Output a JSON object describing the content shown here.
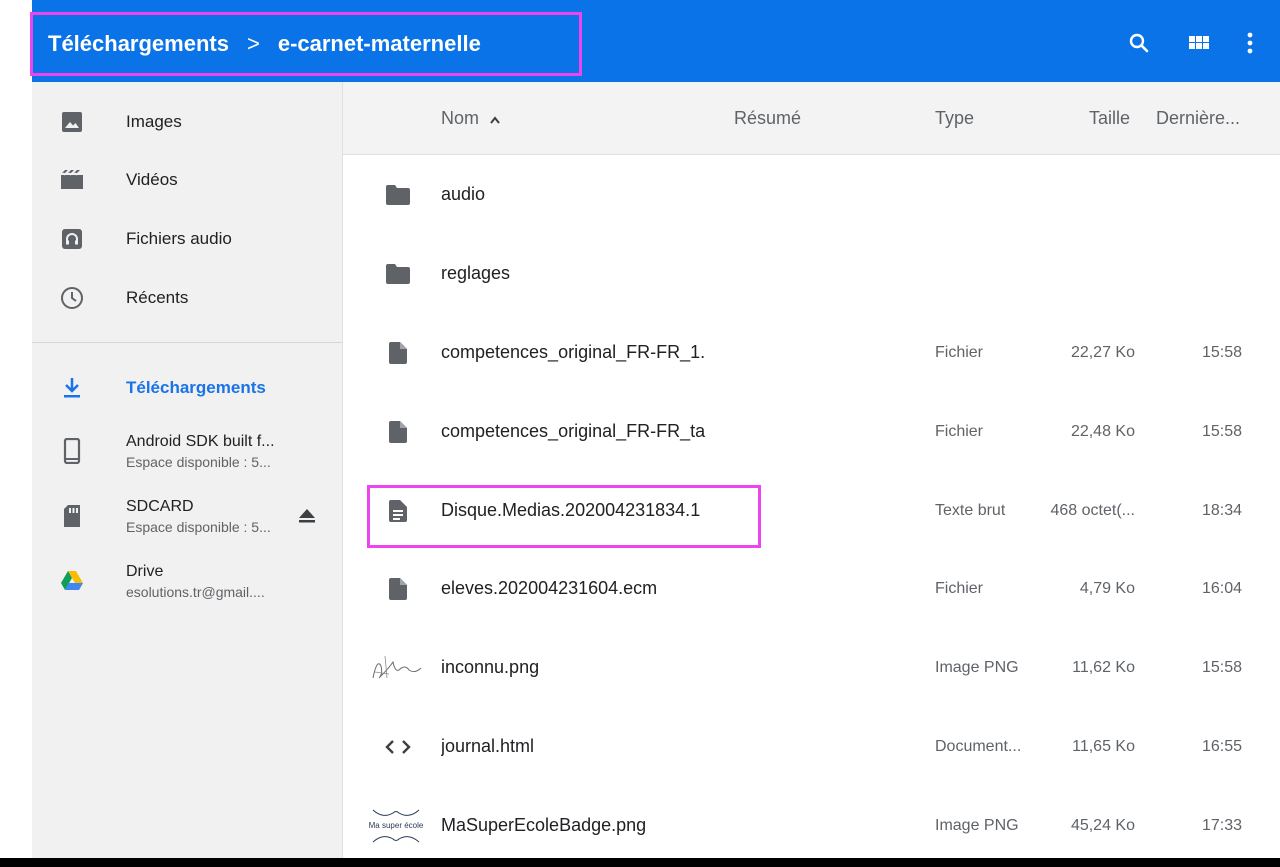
{
  "toolbar": {
    "breadcrumbs": [
      "Téléchargements",
      "e-carnet-maternelle"
    ],
    "separator": ">",
    "icons": [
      "search-icon",
      "grid-view-icon",
      "more-vert-icon"
    ],
    "color": "#0a73e8"
  },
  "sidebar": {
    "items": [
      {
        "label": "Images",
        "icon": "image-icon"
      },
      {
        "label": "Vidéos",
        "icon": "video-icon"
      },
      {
        "label": "Fichiers audio",
        "icon": "audio-icon"
      },
      {
        "label": "Récents",
        "icon": "clock-icon"
      },
      {
        "label": "Téléchargements",
        "icon": "download-icon",
        "active": true
      },
      {
        "label": "Android SDK built f...",
        "sublabel": "Espace disponible : 5...",
        "icon": "phone-icon"
      },
      {
        "label": "SDCARD",
        "sublabel": "Espace disponible : 5...",
        "icon": "sd-card-icon",
        "eject": true
      },
      {
        "label": "Drive",
        "sublabel": "esolutions.tr@gmail....",
        "icon": "drive-icon"
      }
    ],
    "active_color": "#1a73e8"
  },
  "list": {
    "headers": {
      "name": "Nom",
      "sort_indicator": "^",
      "summary": "Résumé",
      "type": "Type",
      "size": "Taille",
      "modified": "Dernière..."
    },
    "rows": [
      {
        "name": "audio",
        "type": "",
        "size": "",
        "date": "",
        "icon": "folder-icon"
      },
      {
        "name": "reglages",
        "type": "",
        "size": "",
        "date": "",
        "icon": "folder-icon"
      },
      {
        "name": "competences_original_FR-FR_1.",
        "type": "Fichier",
        "size": "22,27 Ko",
        "date": "15:58",
        "icon": "file-icon"
      },
      {
        "name": "competences_original_FR-FR_ta",
        "type": "Fichier",
        "size": "22,48 Ko",
        "date": "15:58",
        "icon": "file-icon"
      },
      {
        "name": "Disque.Medias.202004231834.1",
        "type": "Texte brut",
        "size": "468 octet(...",
        "date": "18:34",
        "icon": "text-file-icon"
      },
      {
        "name": "eleves.202004231604.ecm",
        "type": "Fichier",
        "size": "4,79 Ko",
        "date": "16:04",
        "icon": "file-icon"
      },
      {
        "name": "inconnu.png",
        "type": "Image PNG",
        "size": "11,62 Ko",
        "date": "15:58",
        "icon": "signature-thumbnail"
      },
      {
        "name": "journal.html",
        "type": "Document...",
        "size": "11,65 Ko",
        "date": "16:55",
        "icon": "code-icon"
      },
      {
        "name": "MaSuperEcoleBadge.png",
        "type": "Image PNG",
        "size": "45,24 Ko",
        "date": "17:33",
        "icon": "badge-thumbnail",
        "thumbnail_text": "Ma super école"
      }
    ]
  },
  "highlight_color": "#ee44ee"
}
